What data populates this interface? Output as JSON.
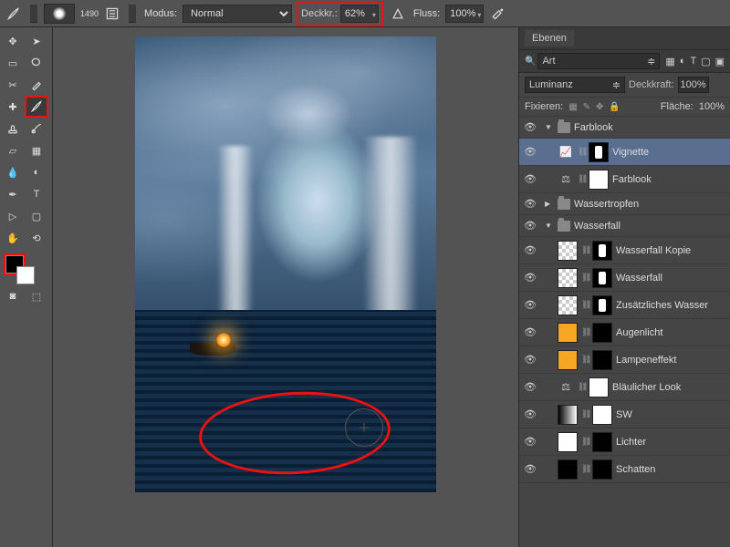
{
  "toolbar": {
    "brush_size": "1490",
    "mode_label": "Modus:",
    "mode_value": "Normal",
    "opacity_label": "Deckkr.:",
    "opacity_value": "62%",
    "flow_label": "Fluss:",
    "flow_value": "100%"
  },
  "panel": {
    "title": "Ebenen",
    "search_value": "Art",
    "blend_value": "Luminanz",
    "opacity_label": "Deckkraft:",
    "opacity_value": "100%",
    "lock_label": "Fixieren:",
    "fill_label": "Fläche:",
    "fill_value": "100%"
  },
  "groups": {
    "farblook": "Farblook",
    "wassertropfen": "Wassertropfen",
    "wasserfall": "Wasserfall"
  },
  "layers": {
    "vignette": "Vignette",
    "farblook": "Farblook",
    "wasserfall_kopie": "Wasserfall Kopie",
    "wasserfall": "Wasserfall",
    "zus_wasser": "Zusätzliches Wasser",
    "augenlicht": "Augenlicht",
    "lampeneffekt": "Lampeneffekt",
    "blau_look": "Bläulicher Look",
    "sw": "SW",
    "lichter": "Lichter",
    "schatten": "Schatten"
  }
}
